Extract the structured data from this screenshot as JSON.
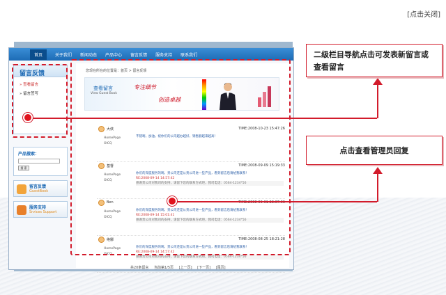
{
  "close_label": "[点击关闭]",
  "nav": {
    "items": [
      "首页",
      "关于我们",
      "新闻动态",
      "产品中心",
      "留言反馈",
      "服务支持",
      "联系我们"
    ]
  },
  "sidebar": {
    "title": "留言反馈",
    "items": [
      "查看留言",
      "留言签写"
    ],
    "search_label": "产品搜索：",
    "search_button": "搜 索",
    "btn1_title": "留言反馈",
    "btn1_sub": "GuestBook",
    "btn2_title": "服务支持",
    "btn2_sub": "Srvices Support"
  },
  "main": {
    "breadcrumb": "您现在所在的位置是：首页 > 留言反馈",
    "banner_title": "查看留言",
    "banner_sub": "View Guest Book",
    "slogan1": "专注细节",
    "slogan2": "创造卓越",
    "messages": [
      {
        "name": "大侠",
        "time": "TIME:2008-10-23 15:47:26",
        "home1": "HomePage",
        "home2": "OICQ",
        "question": "不错啊，加油，祝你们的公司越办越好，销售额越来越高！",
        "reply_head": "",
        "reply": ""
      },
      {
        "name": "基督",
        "time": "TIME:2008-09-09 15:19:33",
        "home1": "HomePage",
        "home2": "OICQ",
        "question": "你们的深度服务的啊，贵公司还是从贵公司进一些产品，看到留言后请给我联系！",
        "reply_head": "RE:2008-09-14 14:57:42",
        "reply": "感谢贵公司对我司的支持，请留下您的联系方式吧，我司电话：0564-1234*56"
      },
      {
        "name": "Ben",
        "time": "TIME:2008-09-01 23:07:06",
        "home1": "HomePage",
        "home2": "OICQ",
        "question": "你们的深度服务的啊，贵公司还是从贵公司进一些产品，看到留言后请给我联系！",
        "reply_head": "RE:2008-09-14 15:01:41",
        "reply": "感谢贵公司对我司的支持，请留下您的联系方式吧，我司电话：0564-1234*56"
      },
      {
        "name": "绝娜",
        "time": "TIME:2008-08-25 18:21:28",
        "home1": "HomePage",
        "home2": "OICQ",
        "question": "你们的深度服务的啊，贵公司还是从贵公司进一些产品，看到留言后请给我联系！",
        "reply_head": "RE:2008-09-14 14:57:42",
        "reply": "感谢贵公司对我司的支持，请留下您的联系方式吧，我司电话：0564-1234*56"
      }
    ],
    "pager": [
      "共20条留言",
      "当前第1/5页",
      "[上一页]",
      "[下一页]",
      "[尾页]"
    ]
  },
  "callouts": {
    "nav_note": "二级栏目导航点击可发表新留言或查看留言",
    "reply_note": "点击查看管理员回复"
  },
  "colors": {
    "annotation": "#d21b2b",
    "nav": "#1d6bb5"
  }
}
